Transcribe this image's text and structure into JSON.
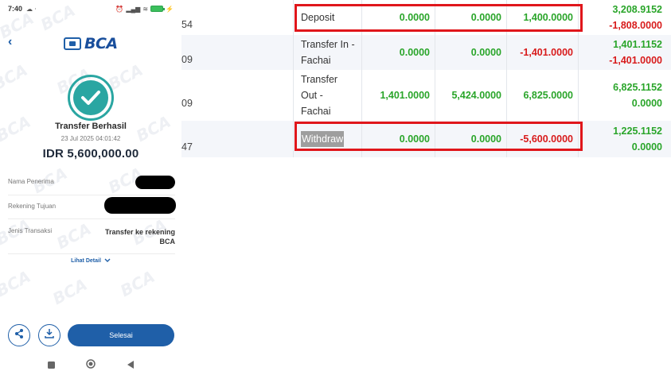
{
  "phone": {
    "status": {
      "time": "7:40"
    },
    "logo_text": "BCA",
    "watermark_text": "BCA",
    "title": "Transfer Berhasil",
    "date": "23 Jul 2025 04:01:42",
    "amount": "IDR 5,600,000.00",
    "details": [
      {
        "label": "Nama Penerima",
        "value": ""
      },
      {
        "label": "Rekening Tujuan",
        "value": ""
      },
      {
        "label": "Jenis Transaksi",
        "value_line1": "Transfer ke rekening",
        "value_line2": "BCA"
      }
    ],
    "lihat_detail": "Lihat Detail",
    "finish_label": "Selesai"
  },
  "ledger": {
    "rows": [
      {
        "id_suffix": "54",
        "type": "Deposit",
        "a": "0.0000",
        "b": "0.0000",
        "c": "1,400.0000",
        "c_sign": "pos",
        "d1": "3,208.9152",
        "d1_sign": "pos",
        "d2": "-1,808.0000",
        "d2_sign": "neg"
      },
      {
        "id_suffix": "09",
        "type": "Transfer In - Fachai",
        "a": "0.0000",
        "b": "0.0000",
        "c": "-1,401.0000",
        "c_sign": "neg",
        "d1": "1,401.1152",
        "d1_sign": "pos",
        "d2": "-1,401.0000",
        "d2_sign": "neg"
      },
      {
        "id_suffix": "09",
        "type": "Transfer Out - Fachai",
        "a": "1,401.0000",
        "b": "5,424.0000",
        "c": "6,825.0000",
        "c_sign": "pos",
        "d1": "6,825.1152",
        "d1_sign": "pos",
        "d2": "0.0000",
        "d2_sign": "pos"
      },
      {
        "id_suffix": "47",
        "type": "Withdraw",
        "a": "0.0000",
        "b": "0.0000",
        "c": "-5,600.0000",
        "c_sign": "neg",
        "d1": "1,225.1152",
        "d1_sign": "pos",
        "d2": "0.0000",
        "d2_sign": "pos"
      }
    ]
  },
  "colors": {
    "positive": "#2aa52a",
    "negative": "#d81b1b",
    "highlight_box": "#e0161b",
    "bca_blue": "#1f5fa8",
    "success_teal": "#2aa6a2"
  },
  "icons": [
    "back-arrow-icon",
    "check-icon",
    "chevron-down-icon",
    "share-icon",
    "download-icon",
    "nav-square-icon",
    "nav-circle-icon",
    "nav-back-triangle-icon"
  ]
}
